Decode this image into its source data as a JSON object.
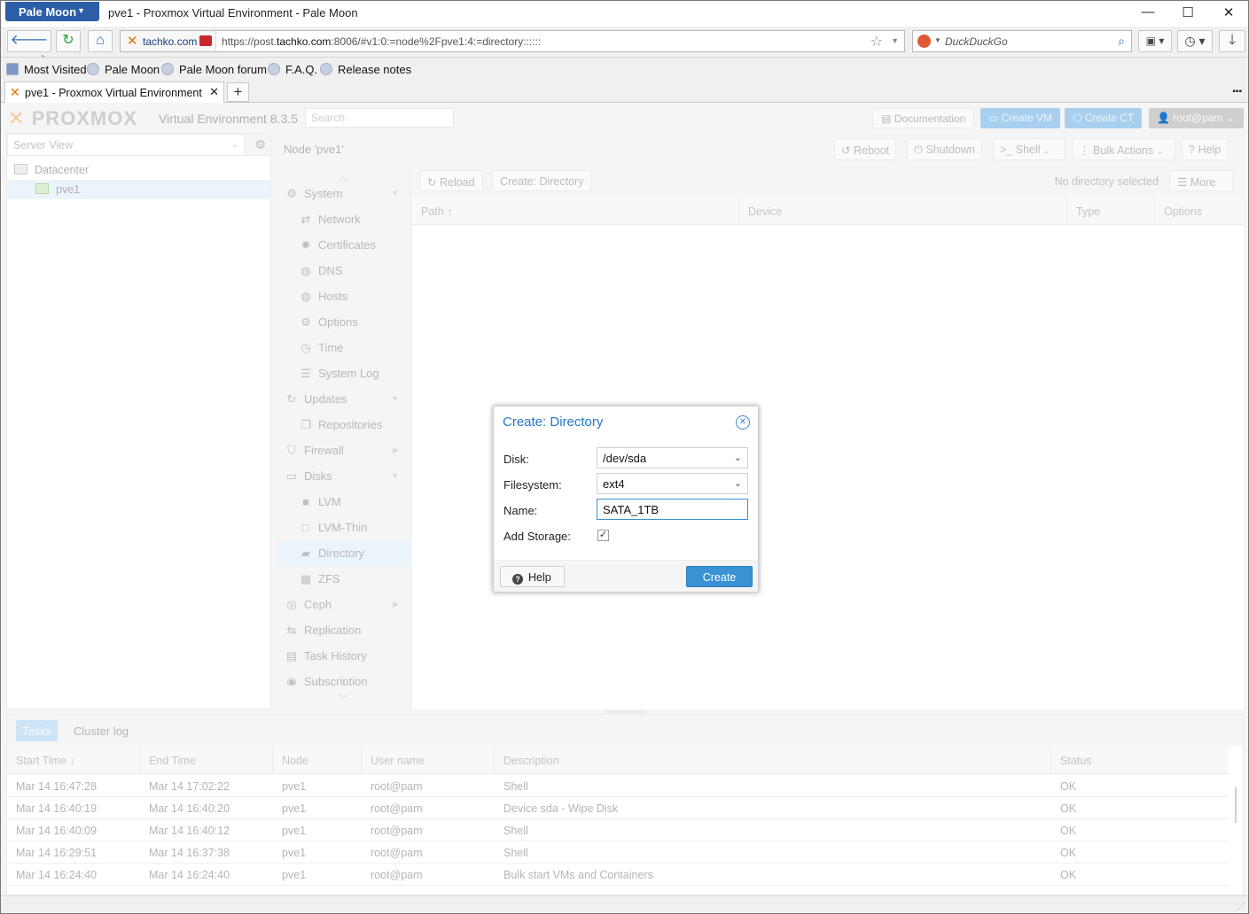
{
  "browser": {
    "app_button": "Pale Moon",
    "window_title": "pve1 - Proxmox Virtual Environment - Pale Moon",
    "identity_domain": "tachko.com",
    "url_prefix": "https://post.",
    "url_host": "tachko.com",
    "url_rest": ":8006/#v1:0:=node%2Fpve1:4:=directory::::::",
    "search_placeholder": "DuckDuckGo",
    "bookmarks": [
      "Most Visited",
      "Pale Moon",
      "Pale Moon forum",
      "F.A.Q.",
      "Release notes"
    ],
    "tab_title": "pve1 - Proxmox Virtual Environment"
  },
  "header": {
    "logo": "PROXMOX",
    "version": "Virtual Environment 8.3.5",
    "search_placeholder": "Search",
    "documentation": "Documentation",
    "create_vm": "Create VM",
    "create_ct": "Create CT",
    "user": "root@pam"
  },
  "tree": {
    "view": "Server View",
    "nodes": [
      "Datacenter",
      "pve1"
    ]
  },
  "node": {
    "title": "Node 'pve1'",
    "buttons": {
      "reboot": "Reboot",
      "shutdown": "Shutdown",
      "shell": "Shell",
      "bulk": "Bulk Actions",
      "help": "Help"
    }
  },
  "menu": [
    {
      "label": "System",
      "level": 1,
      "icon": "gears-icon",
      "arrow": true
    },
    {
      "label": "Network",
      "level": 2,
      "icon": "exchange-icon"
    },
    {
      "label": "Certificates",
      "level": 2,
      "icon": "certificate-icon"
    },
    {
      "label": "DNS",
      "level": 2,
      "icon": "globe-icon"
    },
    {
      "label": "Hosts",
      "level": 2,
      "icon": "globe-icon"
    },
    {
      "label": "Options",
      "level": 2,
      "icon": "gear-icon"
    },
    {
      "label": "Time",
      "level": 2,
      "icon": "clock-icon"
    },
    {
      "label": "System Log",
      "level": 2,
      "icon": "list-icon"
    },
    {
      "label": "Updates",
      "level": 1,
      "icon": "refresh-icon",
      "arrow": true
    },
    {
      "label": "Repositories",
      "level": 2,
      "icon": "files-icon"
    },
    {
      "label": "Firewall",
      "level": 1,
      "icon": "shield-icon",
      "arrow": true
    },
    {
      "label": "Disks",
      "level": 1,
      "icon": "hdd-icon",
      "arrow": true
    },
    {
      "label": "LVM",
      "level": 2,
      "icon": "square-icon"
    },
    {
      "label": "LVM-Thin",
      "level": 2,
      "icon": "square-outline-icon"
    },
    {
      "label": "Directory",
      "level": 2,
      "icon": "folder-icon",
      "selected": true
    },
    {
      "label": "ZFS",
      "level": 2,
      "icon": "grid-icon"
    },
    {
      "label": "Ceph",
      "level": 1,
      "icon": "ceph-icon",
      "arrow": true
    },
    {
      "label": "Replication",
      "level": 1,
      "icon": "retweet-icon"
    },
    {
      "label": "Task History",
      "level": 1,
      "icon": "list-alt-icon"
    },
    {
      "label": "Subscription",
      "level": 1,
      "icon": "support-icon"
    }
  ],
  "content": {
    "reload": "Reload",
    "create_directory": "Create: Directory",
    "no_selection": "No directory selected",
    "more": "More",
    "columns": [
      "Path",
      "Device",
      "Type",
      "Options"
    ]
  },
  "dialog": {
    "title": "Create: Directory",
    "disk_label": "Disk:",
    "disk_value": "/dev/sda",
    "fs_label": "Filesystem:",
    "fs_value": "ext4",
    "name_label": "Name:",
    "name_value": "SATA_1TB",
    "add_storage_label": "Add Storage:",
    "add_storage_checked": true,
    "help": "Help",
    "create": "Create"
  },
  "tasks": {
    "tabs": [
      "Tasks",
      "Cluster log"
    ],
    "columns": [
      "Start Time",
      "End Time",
      "Node",
      "User name",
      "Description",
      "Status"
    ],
    "rows": [
      [
        "Mar 14 16:47:28",
        "Mar 14 17:02:22",
        "pve1",
        "root@pam",
        "Shell",
        "OK"
      ],
      [
        "Mar 14 16:40:19",
        "Mar 14 16:40:20",
        "pve1",
        "root@pam",
        "Device sda - Wipe Disk",
        "OK"
      ],
      [
        "Mar 14 16:40:09",
        "Mar 14 16:40:12",
        "pve1",
        "root@pam",
        "Shell",
        "OK"
      ],
      [
        "Mar 14 16:29:51",
        "Mar 14 16:37:38",
        "pve1",
        "root@pam",
        "Shell",
        "OK"
      ],
      [
        "Mar 14 16:24:40",
        "Mar 14 16:24:40",
        "pve1",
        "root@pam",
        "Bulk start VMs and Containers",
        "OK"
      ]
    ]
  },
  "colors": {
    "accent": "#3892d4",
    "dialog_title": "#2277c6",
    "browser_button": "#2c5ea8",
    "logo_x": "#e57000"
  }
}
